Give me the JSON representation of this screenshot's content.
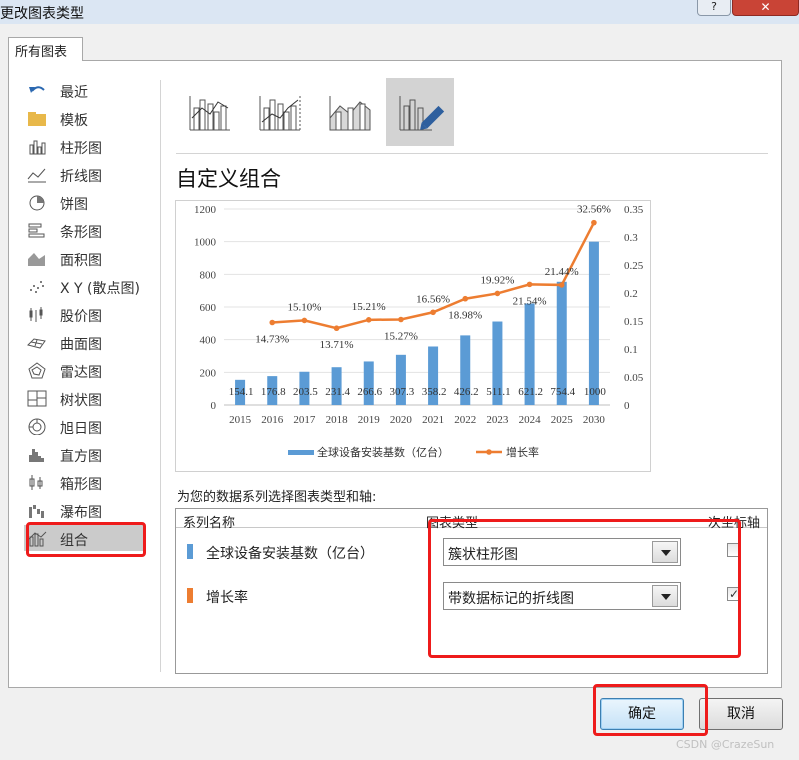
{
  "window": {
    "title": "更改图表类型",
    "help_label": "?",
    "close_label": "✕"
  },
  "tab": {
    "label": "所有图表"
  },
  "sidebar": {
    "items": [
      {
        "label": "最近",
        "icon": "undo-arrow-icon"
      },
      {
        "label": "模板",
        "icon": "folder-icon"
      },
      {
        "label": "柱形图",
        "icon": "column-chart-icon"
      },
      {
        "label": "折线图",
        "icon": "line-chart-icon"
      },
      {
        "label": "饼图",
        "icon": "pie-chart-icon"
      },
      {
        "label": "条形图",
        "icon": "bar-chart-icon"
      },
      {
        "label": "面积图",
        "icon": "area-chart-icon"
      },
      {
        "label": "X Y (散点图)",
        "icon": "scatter-chart-icon"
      },
      {
        "label": "股价图",
        "icon": "stock-chart-icon"
      },
      {
        "label": "曲面图",
        "icon": "surface-chart-icon"
      },
      {
        "label": "雷达图",
        "icon": "radar-chart-icon"
      },
      {
        "label": "树状图",
        "icon": "treemap-chart-icon"
      },
      {
        "label": "旭日图",
        "icon": "sunburst-chart-icon"
      },
      {
        "label": "直方图",
        "icon": "histogram-chart-icon"
      },
      {
        "label": "箱形图",
        "icon": "box-whisker-chart-icon"
      },
      {
        "label": "瀑布图",
        "icon": "waterfall-chart-icon"
      },
      {
        "label": "组合",
        "icon": "combo-chart-icon"
      }
    ],
    "selected": "组合"
  },
  "subtypes": {
    "icons": [
      "clustered-column-line-icon",
      "clustered-column-line-secondary-icon",
      "stacked-area-column-icon",
      "custom-combination-icon"
    ],
    "selected_index": 3
  },
  "heading": "自定义组合",
  "chart_data": {
    "type": "bar",
    "categories": [
      "2015",
      "2016",
      "2017",
      "2018",
      "2019",
      "2020",
      "2021",
      "2022",
      "2023",
      "2024",
      "2025",
      "2030"
    ],
    "series": [
      {
        "name": "全球设备安装基数（亿台）",
        "type": "bar",
        "axis": "primary",
        "color": "#5b9bd5",
        "values": [
          154.1,
          176.8,
          203.5,
          231.4,
          266.6,
          307.3,
          358.2,
          426.2,
          511.1,
          621.2,
          754.4,
          1000
        ],
        "labels": [
          "154.1",
          "176.8",
          "203.5",
          "231.4",
          "266.6",
          "307.3",
          "358.2",
          "426.2",
          "511.1",
          "621.2",
          "754.4",
          "1000"
        ]
      },
      {
        "name": "增长率",
        "type": "line",
        "axis": "secondary",
        "color": "#ed7d31",
        "values": [
          null,
          0.1473,
          0.151,
          0.1371,
          0.1521,
          0.1527,
          0.1656,
          0.1898,
          0.1992,
          0.2154,
          0.2144,
          0.3256
        ],
        "labels": [
          "",
          "14.73%",
          "15.10%",
          "13.71%",
          "15.21%",
          "15.27%",
          "16.56%",
          "18.98%",
          "19.92%",
          "21.54%",
          "21.44%",
          "32.56%"
        ]
      }
    ],
    "ylim": [
      0,
      1200
    ],
    "y_ticks": [
      "0",
      "200",
      "400",
      "600",
      "800",
      "1000",
      "1200"
    ],
    "y2lim": [
      0,
      0.35
    ],
    "y2_ticks": [
      "0",
      "0.05",
      "0.1",
      "0.15",
      "0.2",
      "0.25",
      "0.3",
      "0.35"
    ],
    "grid": true,
    "legend_position": "bottom"
  },
  "assign": {
    "label": "为您的数据系列选择图表类型和轴:",
    "headers": {
      "name": "系列名称",
      "type": "图表类型",
      "secondary": "次坐标轴"
    },
    "rows": [
      {
        "name": "全球设备安装基数（亿台）",
        "color": "#5b9bd5",
        "chart_type": "簇状柱形图",
        "secondary_axis": false
      },
      {
        "name": "增长率",
        "color": "#ed7d31",
        "chart_type": "带数据标记的折线图",
        "secondary_axis": true
      }
    ]
  },
  "buttons": {
    "ok": "确定",
    "cancel": "取消"
  },
  "watermark": "CSDN @CrazeSun"
}
